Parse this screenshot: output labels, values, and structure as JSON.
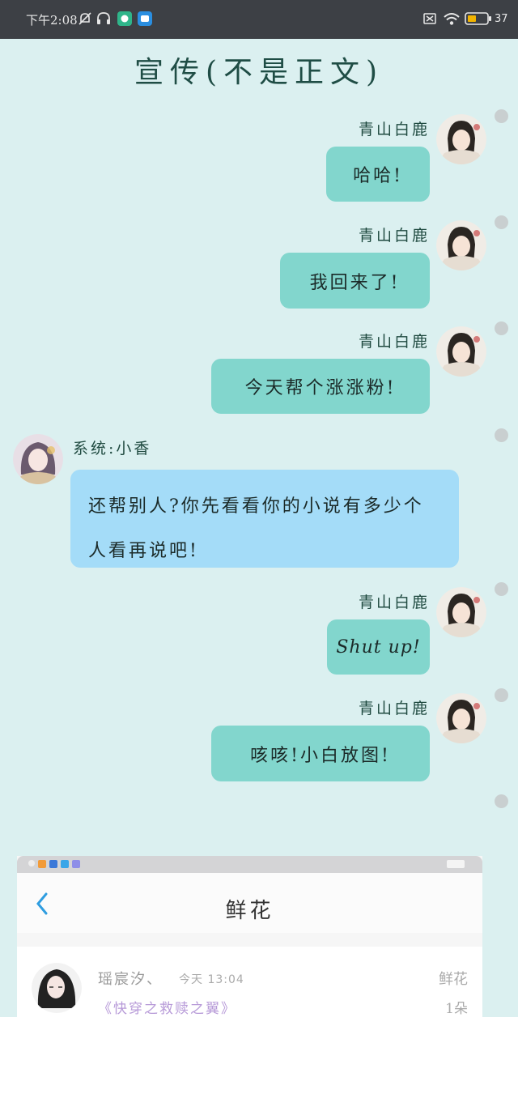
{
  "status_bar": {
    "time": "下午2:08",
    "battery": "37",
    "icons": [
      "mute-bell-icon",
      "headphones-icon",
      "app-icon-green",
      "app-icon-blue",
      "sim-off-icon",
      "wifi-icon",
      "battery-icon"
    ]
  },
  "chat": {
    "title": "宣传(不是正文)",
    "author_name": "青山白鹿",
    "system_name": "系统:小香",
    "messages": [
      {
        "text": "哈哈!"
      },
      {
        "text": "我回来了!"
      },
      {
        "text": "今天帮个涨涨粉!"
      },
      {
        "text": "还帮别人?你先看看你的小说有多少个人看再说吧!"
      },
      {
        "text": "Shut up!"
      },
      {
        "text": "咳咳!小白放图!"
      }
    ]
  },
  "embedded_screenshot": {
    "title": "鲜花",
    "row": {
      "user": "瑶宸汐、",
      "time": "今天 13:04",
      "book": "《快穿之救赎之翼》",
      "gift": "鲜花",
      "count": "1朵"
    }
  },
  "colors": {
    "chat_background": "#dbf0f0",
    "author_bubble": "#82d6cd",
    "system_bubble": "#a4dcf8",
    "status_bar": "#3d4045"
  }
}
